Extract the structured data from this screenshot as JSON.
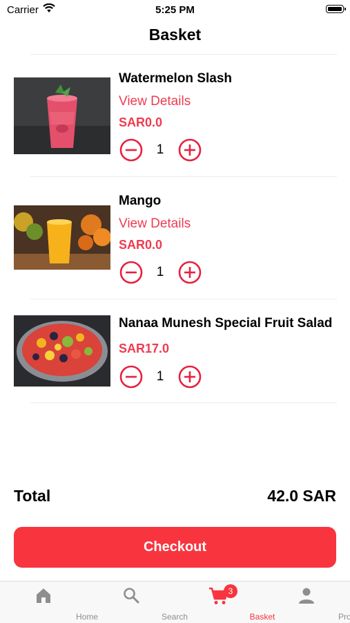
{
  "status_bar": {
    "carrier": "Carrier",
    "time": "5:25 PM"
  },
  "header": {
    "title": "Basket"
  },
  "items": [
    {
      "name": "Watermelon Slash",
      "details_link": "View Details",
      "price": "SAR0.0",
      "quantity": "1"
    },
    {
      "name": "Mango",
      "details_link": "View Details",
      "price": "SAR0.0",
      "quantity": "1"
    },
    {
      "name": "Nanaa Munesh Special Fruit Salad",
      "price": "SAR17.0",
      "quantity": "1"
    }
  ],
  "summary": {
    "total_label": "Total",
    "total_value": "42.0 SAR"
  },
  "checkout_label": "Checkout",
  "tabs": [
    {
      "label": "Home",
      "icon": "home-icon"
    },
    {
      "label": "Search",
      "icon": "search-icon"
    },
    {
      "label": "Basket",
      "icon": "cart-icon",
      "badge": "3",
      "active": true
    },
    {
      "label": "Profile",
      "icon": "person-icon"
    }
  ],
  "colors": {
    "accent": "#f8343f",
    "link": "#ef3b50",
    "tab_inactive": "#8e8e8e"
  }
}
